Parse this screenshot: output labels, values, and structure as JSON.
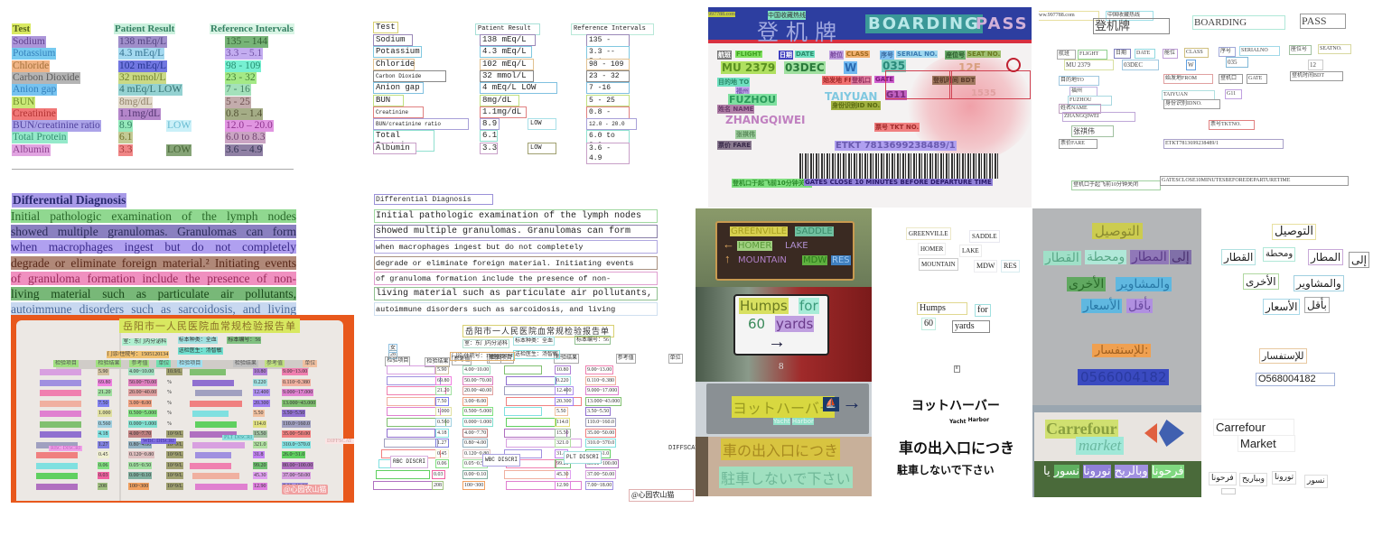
{
  "lab_report": {
    "headers": {
      "test": "Test",
      "result": "Patient Result",
      "reference": "Reference Intervals"
    },
    "rows": [
      {
        "test": "Sodium",
        "result": "138 mEq/L",
        "flag": "",
        "reference": "135 – 144"
      },
      {
        "test": "Potassium",
        "result": "4.3 mEq/L",
        "flag": "",
        "reference": "3.3 – 5.1"
      },
      {
        "test": "Chloride",
        "result": "102 mEq/L",
        "flag": "",
        "reference": "98 - 109"
      },
      {
        "test": "Carbon Dioxide",
        "result": "32 mmol/L",
        "flag": "",
        "reference": "23 - 32"
      },
      {
        "test": "Anion gap",
        "result": "4  mEq/L  LOW",
        "flag": "",
        "reference": "7 - 16"
      },
      {
        "test": "BUN",
        "result": "8mg/dL",
        "flag": "",
        "reference": "5 - 25"
      },
      {
        "test": "Creatinine",
        "result": "1.1mg/dL",
        "flag": "",
        "reference": "0.8 – 1.4"
      },
      {
        "test": "BUN/creatinine ratio",
        "result": "8.9",
        "flag": "LOW",
        "reference": "12.0 – 20.0"
      },
      {
        "test": "Total Protein",
        "result": "6.1",
        "flag": "",
        "reference": "6.0 to 8.3"
      },
      {
        "test": "Albumin",
        "result": "3.3",
        "flag": "LOW",
        "reference": "3.6 – 4.9"
      }
    ],
    "recognized_rows": [
      {
        "test": "Sodium",
        "result": "138 mEq/L",
        "flag": "",
        "reference": "135 - 144"
      },
      {
        "test": "Potassium",
        "result": "4.3 mEq/L",
        "flag": "",
        "reference": "3.3 -- 5.1"
      },
      {
        "test": "Chloride",
        "result": "102 mEq/L",
        "flag": "",
        "reference": "98 - 109"
      },
      {
        "test": "Carbon Dioxide",
        "result": "32 mmol/L",
        "flag": "",
        "reference": "23 - 32"
      },
      {
        "test": "Anion gap",
        "result": "4 mEq/L LOW",
        "flag": "",
        "reference": "7 -16"
      },
      {
        "test": "BUN",
        "result": "8mg/dL",
        "flag": "",
        "reference": "5 - 25"
      },
      {
        "test": "Creatinine",
        "result": "1.1mg/dL",
        "flag": "",
        "reference": "0.8 - 1.4"
      },
      {
        "test": "BUN/creatinine ratio",
        "result": "8.9",
        "flag": "LOW",
        "reference": "12.0 - 20.0"
      },
      {
        "test": "Total Protein",
        "result": "6.1",
        "flag": "",
        "reference": "6.0 to 8.3"
      },
      {
        "test": "Albumin",
        "result": "3.3",
        "flag": "LOW",
        "reference": "3.6 - 4.9"
      }
    ]
  },
  "diagnosis": {
    "title": "Differential Diagnosis",
    "lines": [
      "Initial pathologic examination of the lymph nodes",
      "showed multiple granulomas. Granulomas can form",
      "when macrophages ingest but do not completely",
      "degrade or eliminate foreign material.² Initiating events",
      "of granuloma formation include the presence of non-",
      "living material such as particulate air pollutants,",
      "autoimmune disorders such as sarcoidosis, and living"
    ],
    "recognized_lines": [
      "Initial pathologic examination of the lymph nodes",
      "showed multiple granulomas. Granulomas can form",
      "when macrophages ingest but do not completely",
      "degrade or eliminate foreign material. Initiating events",
      "of granuloma formation include the presence of non-",
      "living material such as particulate air pollutants,",
      "autoimmune disorders such as sarcoidosis, and living"
    ]
  },
  "blood_report": {
    "title": "岳阳市一人民医院血常规检验报告单",
    "col_headers": [
      "检验项目",
      "检验结果",
      "参考值",
      "单位",
      "检验项目",
      "检验结果",
      "参考值",
      "单位"
    ],
    "left_values": [
      "5.90",
      "69.80",
      "21.20",
      "7.50",
      "1.000",
      "0.560",
      "4.18",
      "1.27",
      "0.45",
      "0.06",
      "0.03",
      "208"
    ],
    "left_refs": [
      "4.00~10.00",
      "50.00~70.00",
      "20.00~40.00",
      "3.00~8.00",
      "0.500~5.000",
      "0.000~1.000",
      "4.00~7.70",
      "0.80~4.00",
      "0.120~0.80",
      "0.05~0.50",
      "0.00~0.10",
      "100~300"
    ],
    "right_values": [
      "10.80",
      "0.220",
      "12.400",
      "20.300",
      "5.50",
      "114.0",
      "15.50",
      "321.0",
      "31.8",
      "99.20",
      "45.30",
      "12.90"
    ],
    "right_refs": [
      "9.00~13.00",
      "0.110~0.380",
      "9.000~17.000",
      "13.000~43.000",
      "3.50~5.50",
      "110.0~160.0",
      "35.00~50.00",
      "310.0~370.0",
      "26.0~31.0",
      "80.00~100.00",
      "37.00~50.00",
      "7.00~18.00"
    ],
    "units_mid": [
      "10.9/L",
      "%",
      "%",
      "%",
      "%",
      "%",
      "10^9/L",
      "10^9/L",
      "10^9/L",
      "10^9/L",
      "10^9/L",
      "10^9/L"
    ],
    "labels": {
      "rbc": "RBC DISCRI",
      "wbc": "WBC DISCRI",
      "plt": "PLT DISCRI",
      "diff": "DIFFSCAT"
    },
    "meta": {
      "specimen": "标本种类：全血",
      "specimen_no": "标本编号：56",
      "doctor": "送检医生：汤智敏",
      "dept": "室：东门内分泌科",
      "outpatient": "门诊/住院号：1505120134",
      "age": "28",
      "sex": "女"
    },
    "watermark": "@心园农山猫"
  },
  "boarding_pass": {
    "url": "www.997788.com",
    "site_cn": "中国收藏热线",
    "title_cn": "登机牌",
    "title_en_1": "BOARDING",
    "title_en_2": "PASS",
    "fields": {
      "flight_cn": "航班",
      "flight_en": "FLIGHT",
      "flight": "MU 2379",
      "date_cn": "日期",
      "date_en": "DATE",
      "date": "03DEC",
      "class_cn": "舱位",
      "class_en": "CLASS",
      "class": "W",
      "serial_cn": "序号",
      "serial_en": "SERIAL NO.",
      "serial": "035",
      "seat_cn": "座位号",
      "seat_en": "SEAT NO.",
      "seat": "12F",
      "to_cn_en": "目的地 TO",
      "to_cn": "福州",
      "to": "FUZHOU",
      "from_cn_en": "始发地 FROM",
      "from": "TAIYUAN",
      "gate_cn": "登机口",
      "gate_en": "GATE",
      "gate": "G11",
      "bdt_cn_en": "登机时间 BDT",
      "bdt": "1535",
      "id_cn_en": "身份识别ID NO.",
      "name_cn_en": "姓名 NAME",
      "name": "ZHANGQIWEI",
      "name_cn": "张祺伟",
      "tkt_cn_en": "票号 TKT NO.",
      "tkt": "ETKT 7813699238489/1",
      "fare_cn_en": "票价 FARE",
      "notice_cn": "登机口于起飞前10分钟关闭",
      "notice_en": "GATES CLOSE 10 MINUTES BEFORE DEPARTURE TIME"
    },
    "recognized": {
      "url": "ww.997788.com",
      "site_cn": "中国收藏热线",
      "title_cn": "登机牌",
      "title_en_1": "BOARDING",
      "title_en_2": "PASS",
      "flight_cn": "航班",
      "flight_en": "FLIGHT",
      "date_cn": "日期",
      "date_en": "DATE",
      "class_cn": "舱位",
      "class_en": "CLASS",
      "serial_cn": "序号",
      "serial_en": "SERIALNO",
      "seat_cn": "座位号",
      "seat_en": "SEATNO.",
      "flight": "MU 2379",
      "date": "03DEC",
      "class": "W",
      "serial": "035",
      "seat": "12",
      "to": "目的地TO",
      "from": "始发地FROM",
      "gate_cn": "登机口",
      "gate_en": "GATE",
      "bdt": "登机时间BDT",
      "to_cn": "福州",
      "to_en": "FUZHOU",
      "from_city": "TAIYUAN",
      "gate": "G11",
      "id": "身份识别IDNO.",
      "name_label": "姓名NAME",
      "name": "ZHANGQIWEI",
      "tkt_label": "票号TKTNO.",
      "name_cn": "张祺伟",
      "fare": "票价FARE",
      "tkt": "ETKT7813699238489/1",
      "notice_cn": "登机口于起飞前10分钟关闭",
      "notice_en": "GATESCLOSE10MINUTESBEFOREDEPARTURETIME"
    }
  },
  "signs": {
    "trail": {
      "l1a": "GREENVILLE",
      "l1b": "SADDLE",
      "l2a": "HOMER",
      "l2b": "LAKE",
      "l3a": "MOUNTAIN",
      "l3b": "MDW",
      "l3c": "RES",
      "arrow_left": "←",
      "arrow_up": "↑"
    },
    "humps": {
      "w1": "Humps",
      "w2": "for",
      "w3": "60",
      "w4": "yards",
      "post_number": "8",
      "arrow": "→"
    },
    "yacht": {
      "jp": "ヨットハーバー",
      "en1": "Yacht",
      "en2": "Harbor",
      "arrow": "→"
    },
    "parking": {
      "line1": "車の出入口につき",
      "line2": "駐車しないで下さい"
    }
  },
  "arabic": {
    "title": "التوصيل",
    "line2a": "إلى",
    "line2b": "المطار",
    "line2c": "ومحطة",
    "line2d": "القطار",
    "line3a": "والمشاوير",
    "line3b": "الأخرى",
    "line4a": "بأقل",
    "line4b": "الأسعار",
    "inquiry": "للإستفسار:",
    "phone": "0566004182",
    "recognized_inquiry": "للإستفسار",
    "recognized_phone": "O568004182"
  },
  "carrefour": {
    "brand": "Carrefour",
    "sub": "market",
    "sub_recognized": "Market",
    "arabic_1": "يا",
    "arabic_2": "نسور",
    "arabic_3": "نورونا",
    "arabic_4": "وبالربح",
    "arabic_5": "فرحونا",
    "recognized": [
      "فرحونا",
      "وبباريح",
      "تورونا",
      "نسور"
    ]
  }
}
